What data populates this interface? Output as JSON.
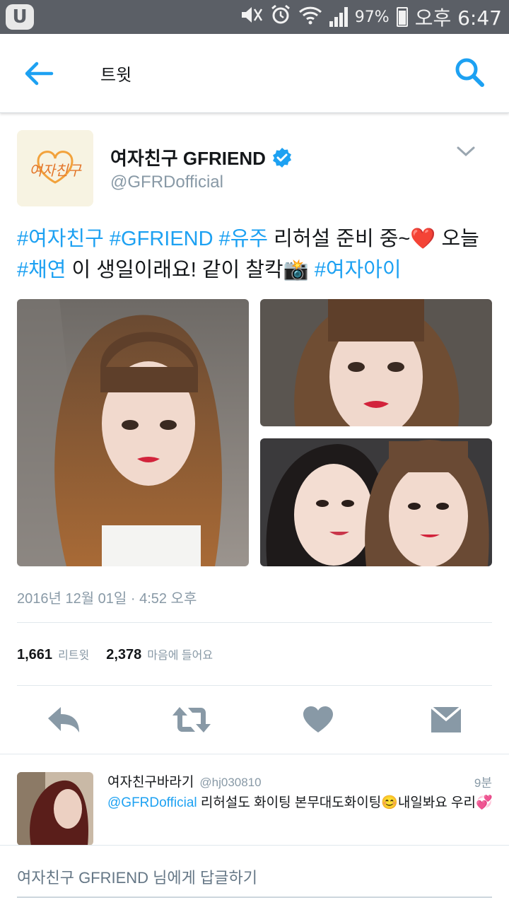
{
  "status_bar": {
    "battery": "97%",
    "time": "오후 6:47"
  },
  "header": {
    "title": "트윗"
  },
  "tweet": {
    "display_name": "여자친구 GFRIEND",
    "handle": "@GFRDofficial",
    "avatar_text": "여자친구",
    "text": {
      "t1": "#여자친구",
      "t2": " ",
      "t3": "#GFRIEND",
      "t4": " ",
      "t5": "#유주",
      "t6": " 리허설 준비 중~❤️ 오늘",
      "t7": "#채연",
      "t8": " 이 생일이래요! 같이 찰칵📸 ",
      "t9": "#여자아이"
    },
    "timestamp": "2016년 12월 01일 · 4:52 오후",
    "retweets": "1,661",
    "retweets_label": "리트윗",
    "likes": "2,378",
    "likes_label": "마음에 들어요"
  },
  "reply": {
    "name": "여자친구바라기",
    "handle": "@hj030810",
    "time": "9분",
    "mention": "@GFRDofficial",
    "text": " 리허설도 화이팅 본무대도화이팅😊내일봐요 우리💞"
  },
  "compose": {
    "placeholder": "여자친구 GFRIEND 님에게 답글하기"
  },
  "colors": {
    "accent": "#1da1f2",
    "icon_gray": "#8899a6",
    "status_bar": "#5b5f66"
  },
  "icons": [
    "back-arrow-icon",
    "search-icon",
    "verified-icon",
    "chevron-down-icon",
    "reply-icon",
    "retweet-icon",
    "heart-icon",
    "direct-message-icon"
  ]
}
